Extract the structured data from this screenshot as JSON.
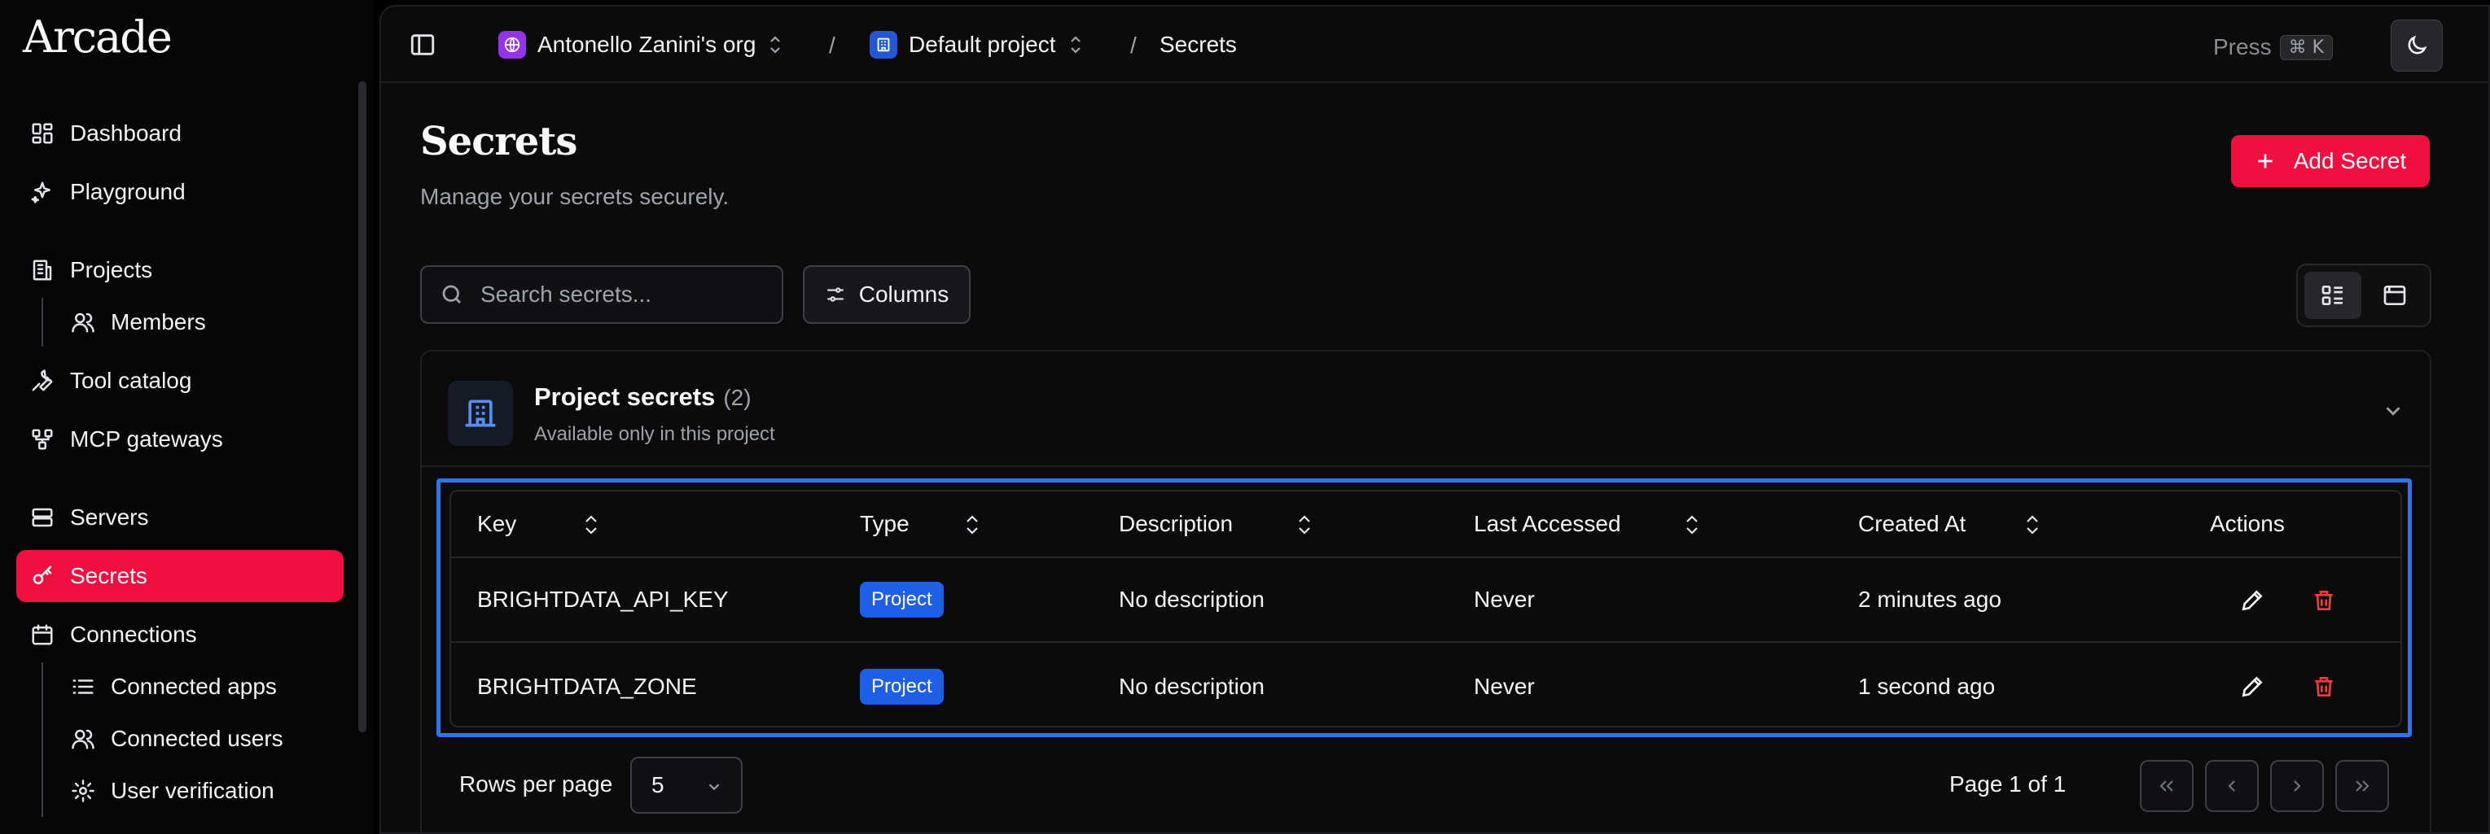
{
  "app": {
    "logo": "Arcade"
  },
  "sidebar": {
    "items": [
      {
        "label": "Dashboard",
        "icon": "dashboard-icon"
      },
      {
        "label": "Playground",
        "icon": "sparkles-icon"
      },
      {
        "label": "Projects",
        "icon": "building-icon"
      },
      {
        "label": "Members",
        "icon": "users-icon"
      },
      {
        "label": "Tool catalog",
        "icon": "wrench-icon"
      },
      {
        "label": "MCP gateways",
        "icon": "network-icon"
      },
      {
        "label": "Servers",
        "icon": "server-icon"
      },
      {
        "label": "Secrets",
        "icon": "key-icon",
        "active": true
      },
      {
        "label": "Connections",
        "icon": "calendar-icon"
      },
      {
        "label": "Connected apps",
        "icon": "list-icon"
      },
      {
        "label": "Connected users",
        "icon": "users-icon"
      },
      {
        "label": "User verification",
        "icon": "gear-icon"
      }
    ]
  },
  "topbar": {
    "org": "Antonello Zanini's org",
    "project": "Default project",
    "page": "Secrets",
    "separator": "/",
    "press_label": "Press",
    "shortcut": "⌘ K"
  },
  "page": {
    "title": "Secrets",
    "subtitle": "Manage your secrets securely.",
    "add_button": "Add Secret"
  },
  "toolbar": {
    "search_placeholder": "Search secrets...",
    "columns_label": "Columns"
  },
  "section": {
    "title": "Project secrets",
    "count": "(2)",
    "subtitle": "Available only in this project"
  },
  "table": {
    "columns": [
      "Key",
      "Type",
      "Description",
      "Last Accessed",
      "Created At",
      "Actions"
    ],
    "rows": [
      {
        "key": "BRIGHTDATA_API_KEY",
        "type": "Project",
        "description": "No description",
        "last_accessed": "Never",
        "created_at": "2 minutes ago"
      },
      {
        "key": "BRIGHTDATA_ZONE",
        "type": "Project",
        "description": "No description",
        "last_accessed": "Never",
        "created_at": "1 second ago"
      }
    ]
  },
  "pagination": {
    "rows_per_page_label": "Rows per page",
    "rows_per_page": "5",
    "page_info": "Page 1 of 1"
  },
  "colors": {
    "accent": "#f0103f",
    "badge_blue": "#1d5fe6",
    "highlight_blue": "#2f75e6",
    "delete_red": "#ef3d3d"
  }
}
